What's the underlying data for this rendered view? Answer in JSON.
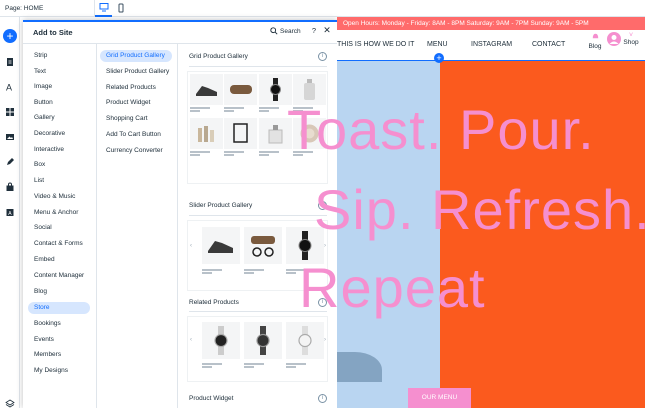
{
  "topbar": {
    "page_label": "Page: HOME"
  },
  "panel": {
    "title": "Add to Site",
    "search_label": "Search",
    "help_glyph": "?",
    "close_glyph": "✕",
    "categories": [
      "Strip",
      "Text",
      "Image",
      "Button",
      "Gallery",
      "Decorative",
      "Interactive",
      "Box",
      "List",
      "Video & Music",
      "Menu & Anchor",
      "Social",
      "Contact & Forms",
      "Embed",
      "Content Manager",
      "Blog",
      "Store",
      "Bookings",
      "Events",
      "Members",
      "My Designs"
    ],
    "active_category": "Store",
    "subcategories": [
      "Grid Product Gallery",
      "Slider Product Gallery",
      "Related Products",
      "Product Widget",
      "Shopping Cart",
      "Add To Cart Button",
      "Currency Converter"
    ],
    "active_subcategory": "Grid Product Gallery",
    "sections": {
      "grid": "Grid Product Gallery",
      "slider": "Slider Product Gallery",
      "related": "Related Products",
      "widget": "Product Widget"
    },
    "info_glyph": "i",
    "arrow_left": "‹",
    "arrow_right": "›"
  },
  "site": {
    "promo": "Open Hours:  Monday - Friday:  8AM - 8PM     Saturday: 9AM - 7PM     Sunday: 9AM - 5PM",
    "nav": {
      "about": "THIS IS HOW WE DO IT",
      "menu": "MENU",
      "instagram": "INSTAGRAM",
      "contact": "CONTACT",
      "blog": "Blog",
      "shop": "Shop"
    },
    "hero": [
      "Toast. Pour.",
      "Sip. Refresh.",
      "Repeat"
    ],
    "menu_button": "OUR MENU",
    "plus_glyph": "+"
  },
  "colors": {
    "accent": "#116dff",
    "hero_pink": "#f58fcf",
    "hero_orange": "#fb5a1e",
    "hero_blue": "#b9d5f1"
  }
}
